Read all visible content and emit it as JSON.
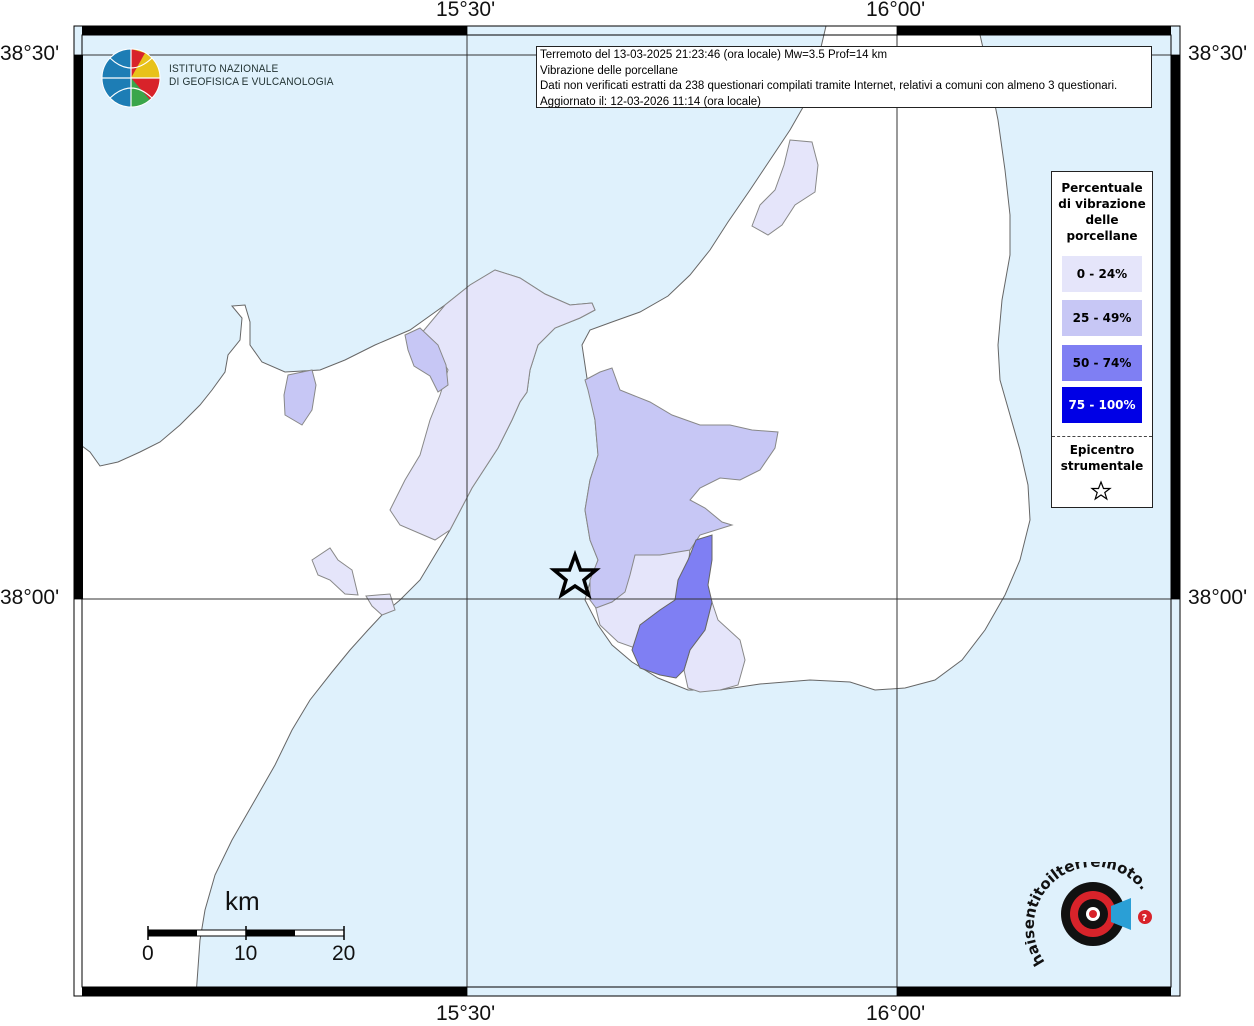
{
  "map": {
    "coords": {
      "top_left": "15°30'",
      "top_right": "16°00'",
      "bottom_left": "15°30'",
      "bottom_right": "16°00'",
      "left_top": "38°30'",
      "left_bottom": "38°00'",
      "right_top": "38°30'",
      "right_bottom": "38°00'"
    },
    "colors": {
      "sea": "#dff1fc",
      "land": "#ffffff",
      "class_0_24": "#e5e5fa",
      "class_25_49": "#c7c7f5",
      "class_50_74": "#7f7ff3",
      "class_75_100": "#0000e6"
    }
  },
  "logo": {
    "line1": "ISTITUTO NAZIONALE",
    "line2": "DI GEOFISICA E VULCANOLOGIA",
    "icon": "ingv-globe-icon"
  },
  "info": {
    "line1": "Terremoto del 13-03-2025 21:23:46 (ora locale) Mw=3.5 Prof=14 km",
    "line2": "Vibrazione delle porcellane",
    "line3": "Dati non verificati estratti da 238 questionari compilati tramite Internet, relativi a comuni con almeno 3 questionari.",
    "line4": "Aggiornato il: 12-03-2026 11:14 (ora locale)"
  },
  "legend": {
    "title": "Percentuale di vibrazione delle porcellane",
    "items": [
      {
        "label": "0 - 24%",
        "color": "#e5e5fa",
        "text_color": "#000000"
      },
      {
        "label": "25 - 49%",
        "color": "#c7c7f5",
        "text_color": "#000000"
      },
      {
        "label": "50 - 74%",
        "color": "#7f7ff3",
        "text_color": "#000000"
      },
      {
        "label": "75 - 100%",
        "color": "#0000e6",
        "text_color": "#ffffff"
      }
    ],
    "epicenter_label": "Epicentro strumentale",
    "epicenter_icon": "star-icon"
  },
  "scale": {
    "unit": "km",
    "ticks": [
      "0",
      "10",
      "20"
    ]
  },
  "hs_logo": {
    "text": "haisentitoilterremoto.it",
    "icon": "haisentito-target-icon"
  }
}
